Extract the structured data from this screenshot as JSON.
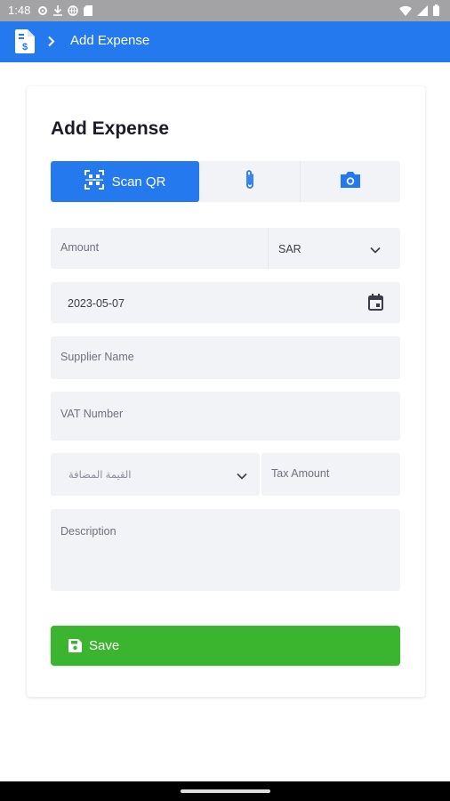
{
  "status_bar": {
    "time": "1:48",
    "left_icons": [
      "gear-icon",
      "download-icon",
      "globe-icon",
      "sd-card-icon"
    ],
    "right_icons": [
      "wifi-icon",
      "signal-icon",
      "battery-icon"
    ]
  },
  "app_bar": {
    "icon": "invoice-dollar-icon",
    "breadcrumb_separator_icon": "chevron-right-icon",
    "title": "Add Expense",
    "background": "#2379ed"
  },
  "form": {
    "title": "Add Expense",
    "mode_tabs": [
      {
        "label": "Scan QR",
        "icon": "qr-scan-icon",
        "selected": true
      },
      {
        "label": "",
        "icon": "paperclip-icon",
        "selected": false
      },
      {
        "label": "",
        "icon": "camera-icon",
        "selected": false
      }
    ],
    "amount": {
      "placeholder": "Amount",
      "currency": "SAR"
    },
    "date": {
      "value": "2023-05-07",
      "icon": "calendar-icon"
    },
    "supplier": {
      "placeholder": "Supplier Name"
    },
    "vat_number": {
      "placeholder": "VAT Number"
    },
    "vat_type": {
      "placeholder": "القيمة المضافة"
    },
    "tax_amount": {
      "placeholder": "Tax Amount"
    },
    "description": {
      "placeholder": "Description"
    },
    "save_button": {
      "label": "Save",
      "icon": "floppy-disk-icon",
      "color": "#3bb52f"
    }
  }
}
